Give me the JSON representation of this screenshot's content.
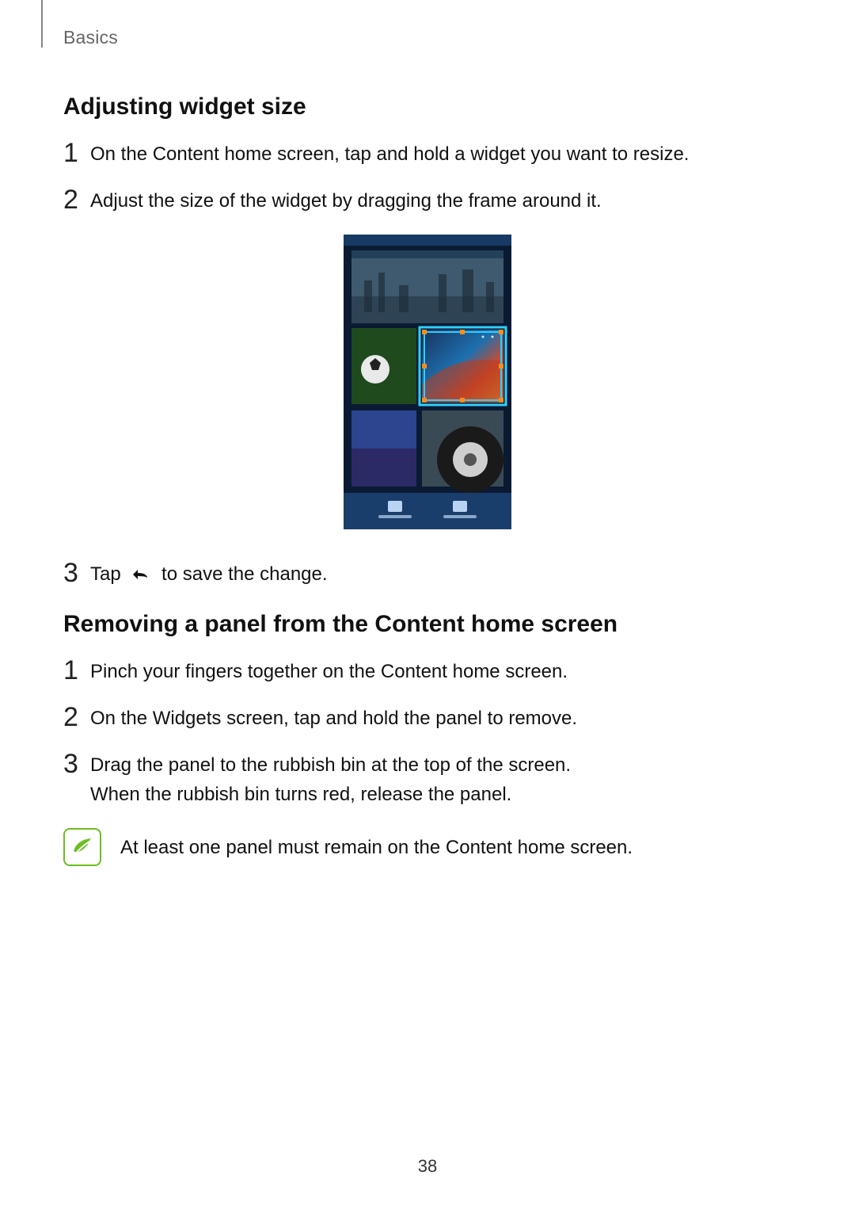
{
  "header": {
    "section": "Basics"
  },
  "page_number": "38",
  "sections": {
    "adjust": {
      "heading": "Adjusting widget size",
      "steps": {
        "1": "On the Content home screen, tap and hold a widget you want to resize.",
        "2": "Adjust the size of the widget by dragging the frame around it.",
        "3a": "Tap ",
        "3b": " to save the change."
      }
    },
    "remove": {
      "heading": "Removing a panel from the Content home screen",
      "steps": {
        "1": "Pinch your fingers together on the Content home screen.",
        "2": "On the Widgets screen, tap and hold the panel to remove.",
        "3": "Drag the panel to the rubbish bin at the top of the screen.\nWhen the rubbish bin turns red, release the panel."
      },
      "note": "At least one panel must remain on the Content home screen."
    }
  }
}
